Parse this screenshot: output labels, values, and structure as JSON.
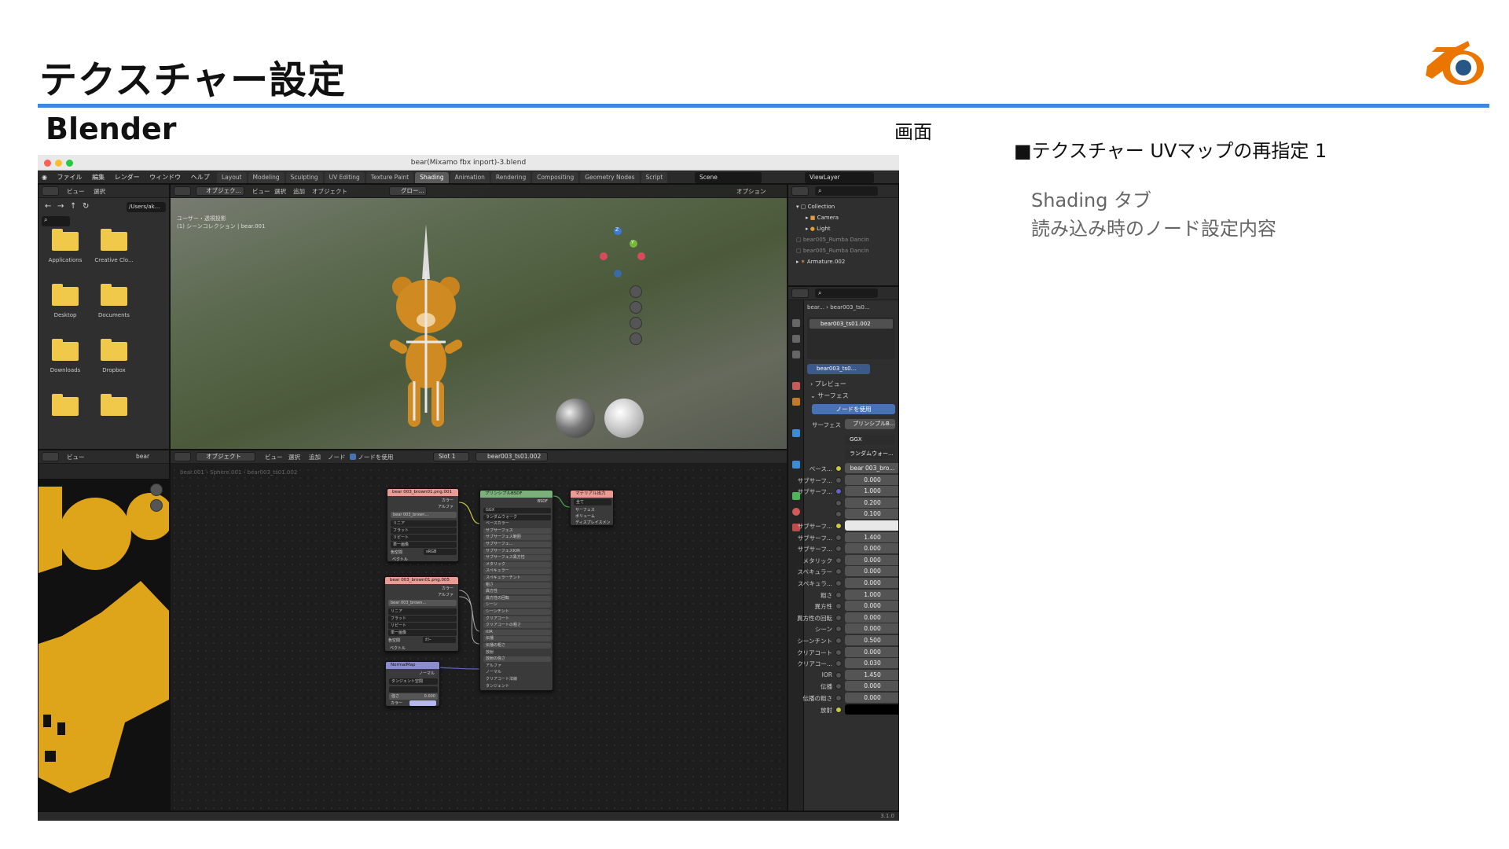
{
  "slide": {
    "title": "テクスチャー設定",
    "subtitle": "Blender",
    "screen_label": "画面",
    "section_heading": "■テクスチャー UVマップの再指定 1",
    "desc_line1": "Shading タブ",
    "desc_line2": "読み込み時のノード設定内容",
    "accent_color": "#3c86e3"
  },
  "window": {
    "title": "bear(Mixamo fbx inport)-3.blend",
    "menu": [
      "ファイル",
      "編集",
      "レンダー",
      "ウィンドウ",
      "ヘルプ"
    ],
    "workspace_tabs": [
      "Layout",
      "Modeling",
      "Sculpting",
      "UV Editing",
      "Texture Paint",
      "Shading",
      "Animation",
      "Rendering",
      "Compositing",
      "Geometry Nodes",
      "Script"
    ],
    "active_tab": "Shading",
    "scene": "Scene",
    "view_layer": "ViewLayer",
    "version": "3.1.0"
  },
  "file_browser": {
    "header_items": [
      "ビュー",
      "選択"
    ],
    "path": "/Users/ak...",
    "folders": [
      "Applications",
      "Creative Clo...",
      "Desktop",
      "Documents",
      "Downloads",
      "Dropbox"
    ]
  },
  "viewport": {
    "mode": "オブジェク...",
    "menu": [
      "ビュー",
      "選択",
      "追加",
      "オブジェクト"
    ],
    "shading": "グロー...",
    "options": "オプション",
    "info_line1": "ユーザー・透視投影",
    "info_line2": "(1) シーンコレクション | bear.001",
    "gizmo_z": "Z",
    "gizmo_y": "Y"
  },
  "outliner": {
    "items": [
      {
        "label": "Collection",
        "dim": false
      },
      {
        "label": "Camera",
        "dim": false
      },
      {
        "label": "Light",
        "dim": false
      },
      {
        "label": "bear005_Rumba Dancin",
        "dim": true
      },
      {
        "label": "bear005_Rumba Dancin",
        "dim": true
      },
      {
        "label": "Armature.002",
        "dim": false
      }
    ]
  },
  "properties": {
    "breadcrumb_obj": "bear...",
    "breadcrumb_mat": "bear003_ts0...",
    "slot_name": "bear003_ts01.002",
    "material_field": "bear003_ts0...",
    "preview_label": "プレビュー",
    "surface_panel": "サーフェス",
    "use_nodes": "ノードを使用",
    "surface_label": "サーフェス",
    "surface_value": "プリンシプルB...",
    "distribution": "GGX",
    "subsurface_method": "ランダムウォー...",
    "rows": [
      {
        "label": "ベース...",
        "value": "bear 003_bro..."
      },
      {
        "label": "サブサーフ...",
        "value": "0.000"
      },
      {
        "label": "サブサーフ...",
        "value": "1.000"
      },
      {
        "label": "",
        "value": "0.200"
      },
      {
        "label": "",
        "value": "0.100"
      },
      {
        "label": "サブサーフ...",
        "value": ""
      },
      {
        "label": "サブサーフ...",
        "value": "1.400"
      },
      {
        "label": "サブサーフ...",
        "value": "0.000"
      },
      {
        "label": "メタリック",
        "value": "0.000"
      },
      {
        "label": "スペキュラー",
        "value": "0.000"
      },
      {
        "label": "スペキュラ...",
        "value": "0.000"
      },
      {
        "label": "粗さ",
        "value": "1.000"
      },
      {
        "label": "異方性",
        "value": "0.000"
      },
      {
        "label": "異方性の回転",
        "value": "0.000"
      },
      {
        "label": "シーン",
        "value": "0.000"
      },
      {
        "label": "シーンチント",
        "value": "0.500"
      },
      {
        "label": "クリアコート",
        "value": "0.000"
      },
      {
        "label": "クリアコー...",
        "value": "0.030"
      },
      {
        "label": "IOR",
        "value": "1.450"
      },
      {
        "label": "伝播",
        "value": "0.000"
      },
      {
        "label": "伝播の粗さ",
        "value": "0.000"
      },
      {
        "label": "放射",
        "value": ""
      }
    ]
  },
  "uv_editor": {
    "header_items": [
      "ビュー"
    ],
    "image": "bear"
  },
  "node_editor": {
    "mode": "オブジェクト",
    "menu": [
      "ビュー",
      "選択",
      "追加",
      "ノード"
    ],
    "use_nodes": "ノードを使用",
    "slot": "Slot 1",
    "material": "bear003_ts01.002",
    "breadcrumb": [
      "bear.001",
      "Sphere.001",
      "bear003_ts01.002"
    ],
    "tex1": {
      "title": "bear 003_brown01.png.001",
      "outputs": [
        "カラー",
        "アルファ"
      ],
      "image": "bear 003_brown...",
      "options": [
        "リニア",
        "フラット",
        "リピート",
        "単一画像"
      ],
      "colorspace_label": "色空間",
      "colorspace": "sRGB",
      "vector": "ベクトル"
    },
    "tex2": {
      "title": "bear 003_brown01.png.005",
      "outputs": [
        "カラー",
        "アルファ"
      ],
      "image": "bear 003_brown...",
      "options": [
        "リニア",
        "フラット",
        "リピート",
        "単一画像"
      ],
      "colorspace_label": "色空間",
      "colorspace": "ｶﾗｰ",
      "vector": "ベクトル"
    },
    "normal": {
      "title": "NormalMap",
      "output": "ノーマル",
      "space": "タンジェント空間",
      "strength_label": "強さ",
      "strength": "0.000",
      "color": "カラー"
    },
    "bsdf": {
      "title": "プリンシプルBSDF",
      "output": "BSDF",
      "rows": [
        "GGX",
        "ランダムウォーク",
        "ベースカラー",
        "サブサーフェス",
        "サブサーフェス範囲",
        "サブサーフェ...",
        "サブサーフェスIOR",
        "サブサーフェス異方性",
        "メタリック",
        "スペキュラー",
        "スペキュラーチント",
        "粗さ",
        "異方性",
        "異方性の回転",
        "シーン",
        "シーンチント",
        "クリアコート",
        "クリアコートの粗さ",
        "IOR",
        "伝播",
        "伝播の粗さ",
        "放射",
        "放射の強さ",
        "アルファ",
        "ノーマル",
        "クリアコート法線",
        "タンジェント"
      ]
    },
    "output_node": {
      "title": "マテリアル出力",
      "target": "全て",
      "inputs": [
        "サーフェス",
        "ボリューム",
        "ディスプレイスメント"
      ]
    }
  }
}
